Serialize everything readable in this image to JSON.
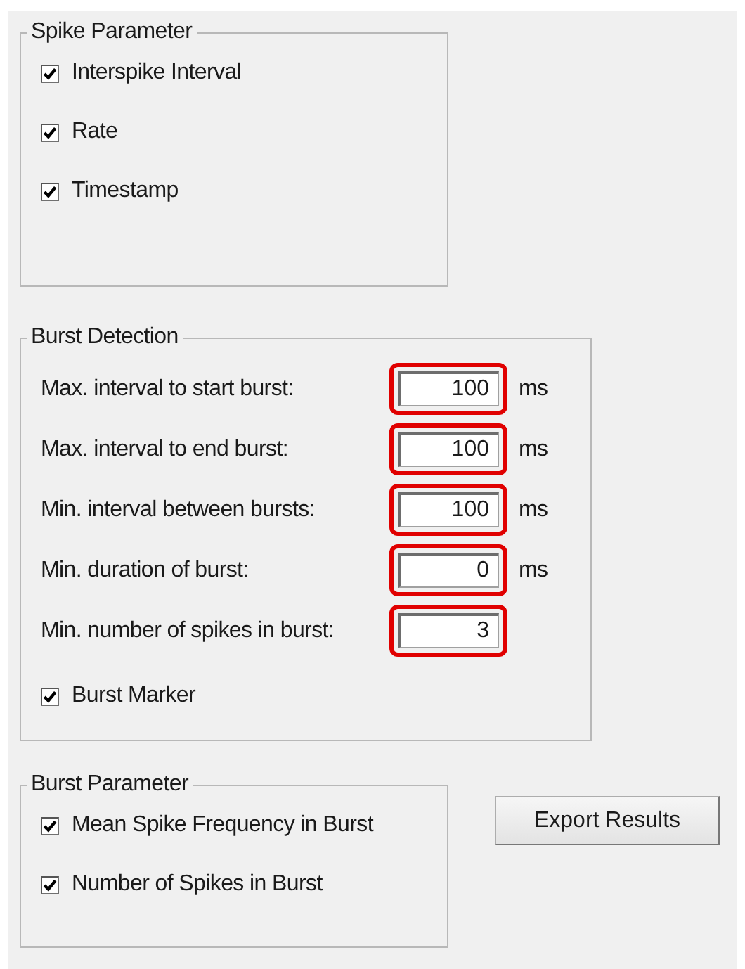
{
  "spike_parameter": {
    "title": "Spike Parameter",
    "options": [
      {
        "label": "Interspike Interval",
        "checked": true
      },
      {
        "label": "Rate",
        "checked": true
      },
      {
        "label": "Timestamp",
        "checked": true
      }
    ]
  },
  "burst_detection": {
    "title": "Burst Detection",
    "fields": [
      {
        "label": "Max. interval to start burst:",
        "value": "100",
        "unit": "ms",
        "highlighted": true
      },
      {
        "label": "Max. interval to end burst:",
        "value": "100",
        "unit": "ms",
        "highlighted": true
      },
      {
        "label": "Min. interval between bursts:",
        "value": "100",
        "unit": "ms",
        "highlighted": true
      },
      {
        "label": "Min. duration of burst:",
        "value": "0",
        "unit": "ms",
        "highlighted": true
      },
      {
        "label": "Min. number of spikes in burst:",
        "value": "3",
        "highlighted": true
      }
    ],
    "marker": {
      "label": "Burst Marker",
      "checked": true
    }
  },
  "burst_parameter": {
    "title": "Burst Parameter",
    "options": [
      {
        "label": "Mean Spike Frequency in Burst",
        "checked": true
      },
      {
        "label": "Number of Spikes in Burst",
        "checked": true
      }
    ]
  },
  "export_button": "Export Results"
}
